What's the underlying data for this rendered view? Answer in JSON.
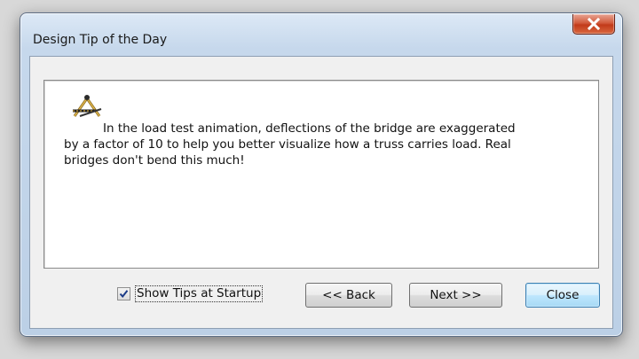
{
  "window": {
    "title": "Design Tip of the Day"
  },
  "tip": {
    "icon": "compass-square-icon",
    "line1": "In the load test animation, deflections of the bridge are exaggerated",
    "line2": "by a factor of 10 to help you better visualize how a truss carries load. Real",
    "line3": "bridges don't bend this much!"
  },
  "footer": {
    "show_tips_label": "Show Tips at Startup",
    "show_tips_checked": true,
    "back_label": "<< Back",
    "next_label": "Next >>",
    "close_label": "Close"
  }
}
